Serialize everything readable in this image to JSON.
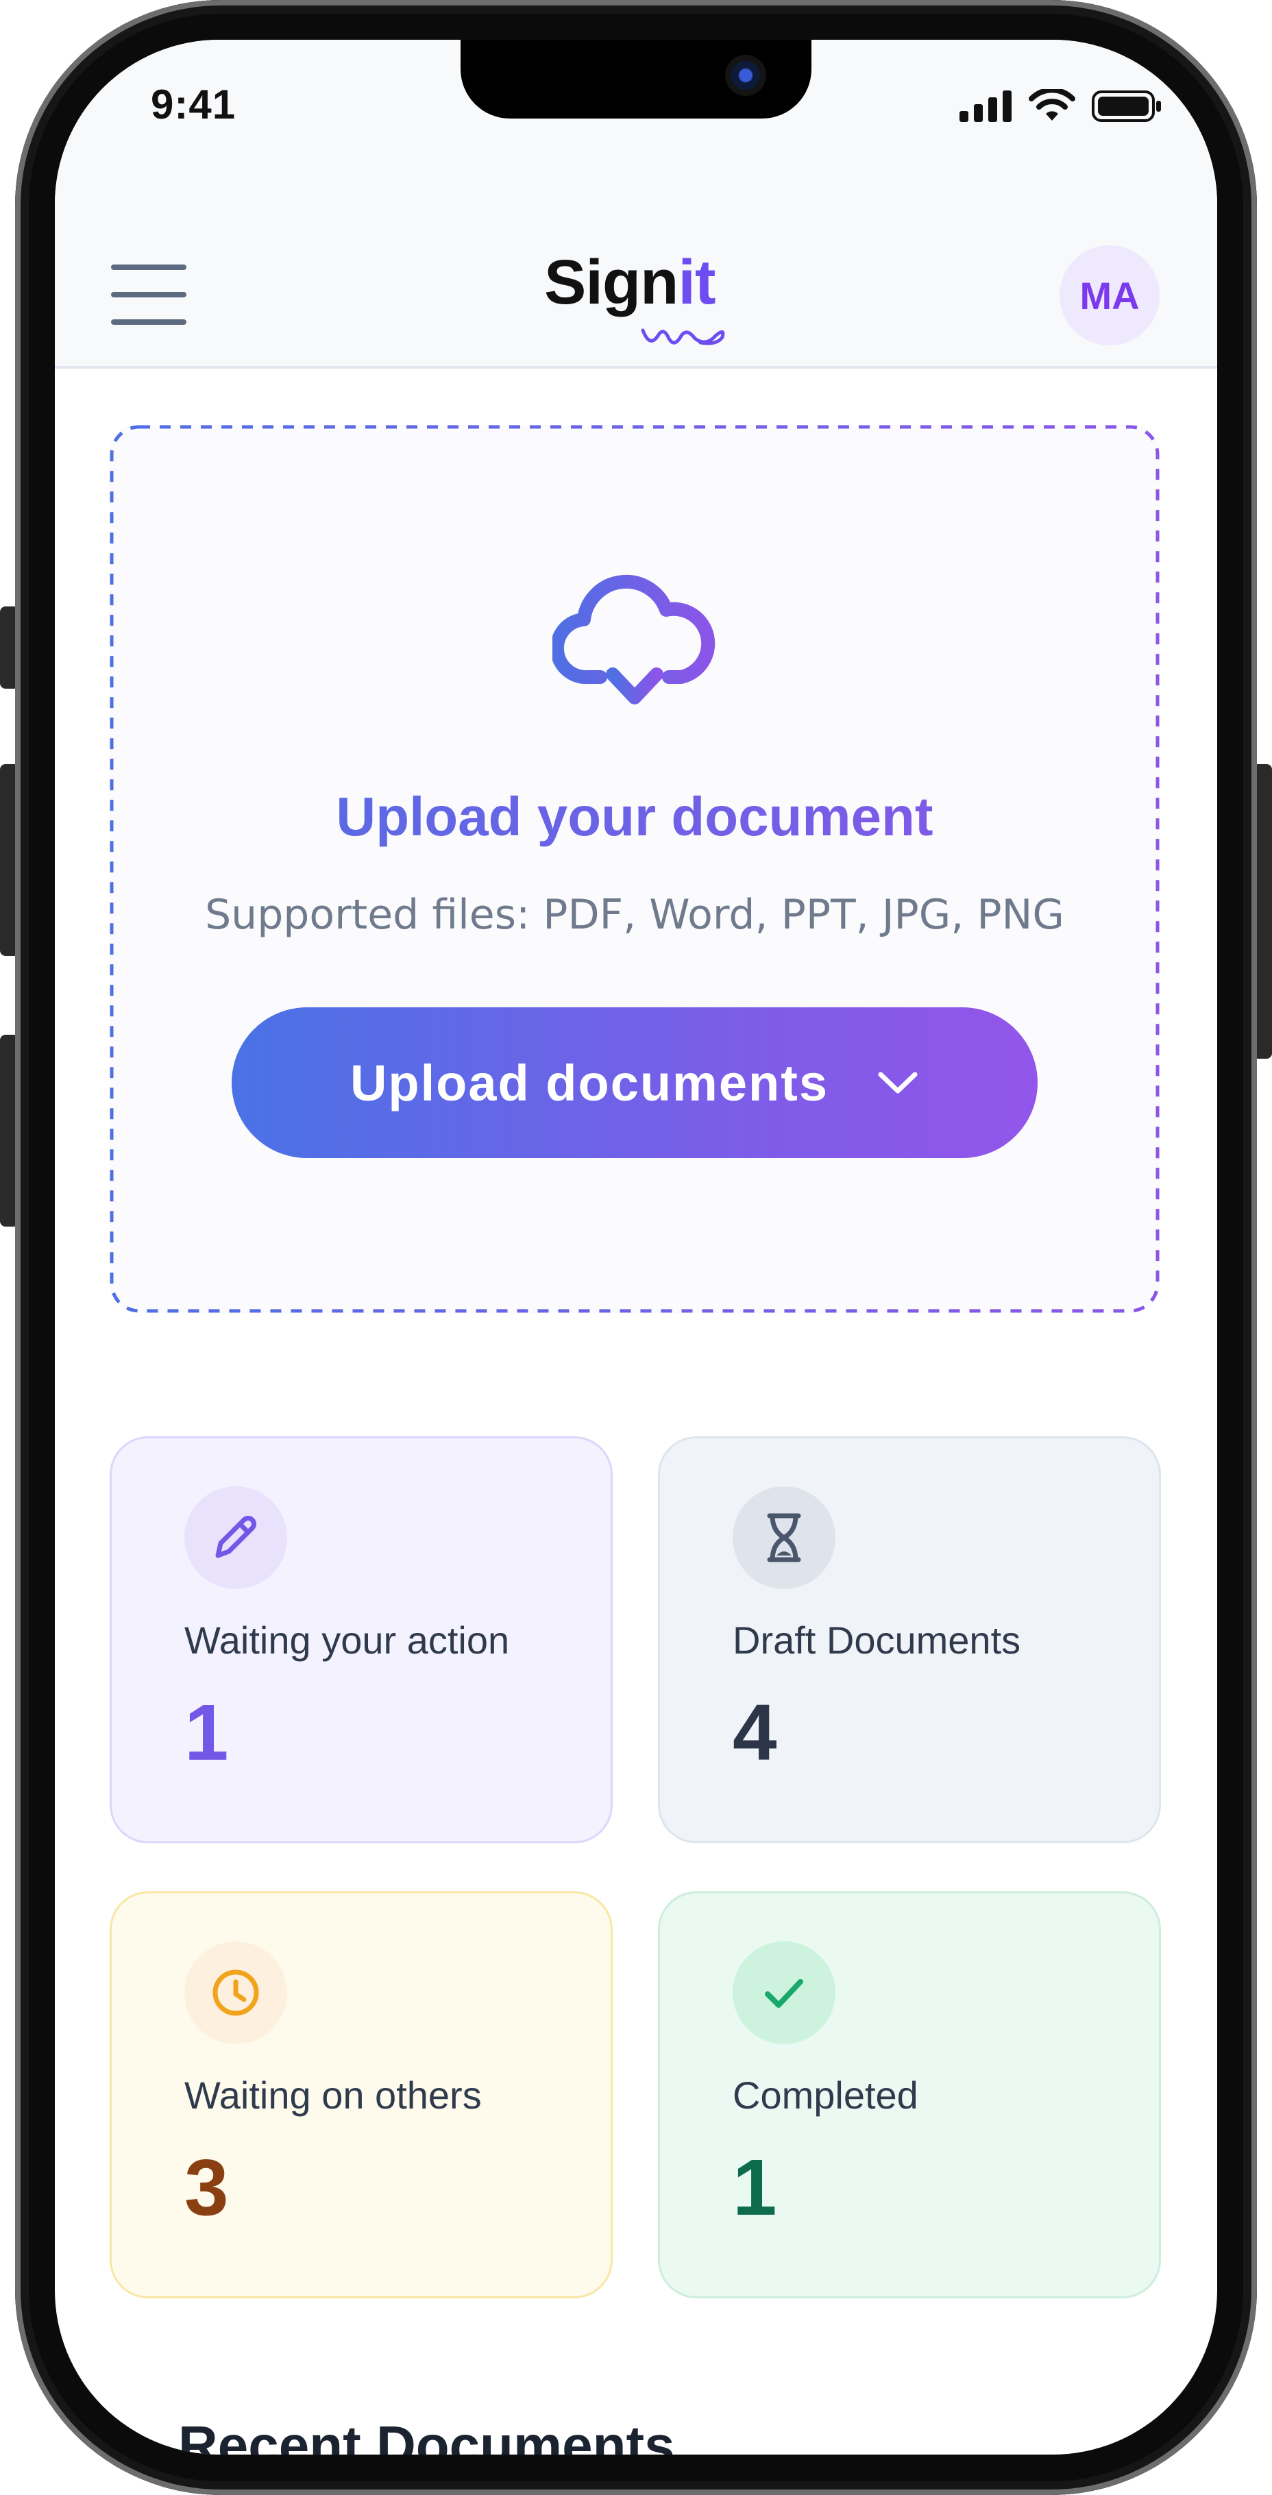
{
  "status_bar": {
    "time": "9:41",
    "icons": [
      "cellular-signal-icon",
      "wifi-icon",
      "battery-icon"
    ]
  },
  "header": {
    "logo_main": "Sign",
    "logo_accent": "it",
    "avatar_initials": "MA"
  },
  "upload": {
    "title": "Upload your document",
    "subtitle": "Supported files: PDF, Word, PPT, JPG, PNG",
    "button_label": "Upload documents",
    "icon": "cloud-download-icon"
  },
  "stats": [
    {
      "label": "Waiting your action",
      "count": "1",
      "icon": "pencil-icon"
    },
    {
      "label": "Draft Documents",
      "count": "4",
      "icon": "hourglass-icon"
    },
    {
      "label": "Waiting on others",
      "count": "3",
      "icon": "clock-icon"
    },
    {
      "label": "Completed",
      "count": "1",
      "icon": "check-icon"
    }
  ],
  "next_section": {
    "title": "Recent Documents"
  },
  "colors": {
    "accent_blue": "#4f6fe3",
    "accent_purple": "#8b55e8",
    "avatar_text": "#7c3aed"
  }
}
